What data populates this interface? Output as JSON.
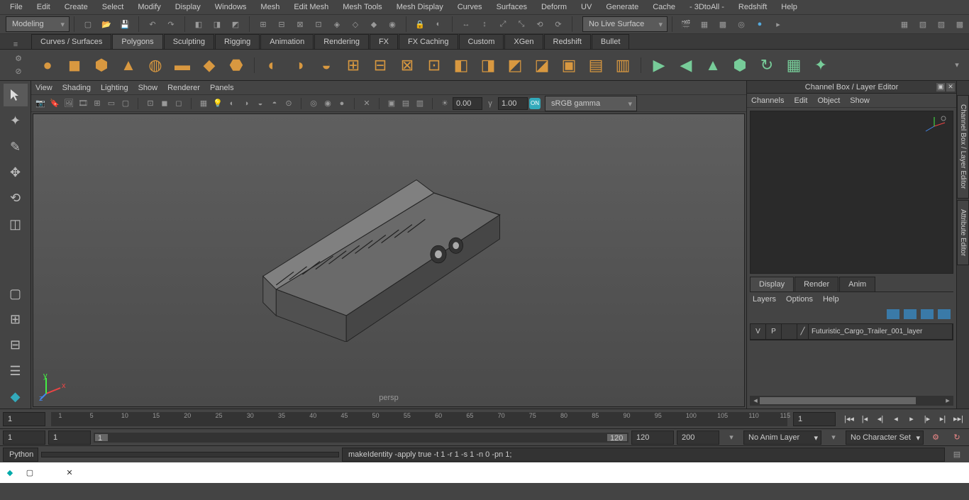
{
  "topmenu": [
    "File",
    "Edit",
    "Create",
    "Select",
    "Modify",
    "Display",
    "Windows",
    "Mesh",
    "Edit Mesh",
    "Mesh Tools",
    "Mesh Display",
    "Curves",
    "Surfaces",
    "Deform",
    "UV",
    "Generate",
    "Cache",
    "- 3DtoAll -",
    "Redshift",
    "Help"
  ],
  "workspace": "Modeling",
  "livesurface": "No Live Surface",
  "shelftabs": [
    "Curves / Surfaces",
    "Polygons",
    "Sculpting",
    "Rigging",
    "Animation",
    "Rendering",
    "FX",
    "FX Caching",
    "Custom",
    "XGen",
    "Redshift",
    "Bullet"
  ],
  "active_shelf": "Polygons",
  "panelmenu": [
    "View",
    "Shading",
    "Lighting",
    "Show",
    "Renderer",
    "Panels"
  ],
  "panel_exposure": "0.00",
  "panel_gamma": "1.00",
  "colorspace": "sRGB gamma",
  "camera": "persp",
  "right_title": "Channel Box / Layer Editor",
  "chmenu": [
    "Channels",
    "Edit",
    "Object",
    "Show"
  ],
  "layertabs": [
    "Display",
    "Render",
    "Anim"
  ],
  "active_layertab": "Display",
  "layermenu": [
    "Layers",
    "Options",
    "Help"
  ],
  "layer": {
    "v": "V",
    "p": "P",
    "name": "Futuristic_Cargo_Trailer_001_layer"
  },
  "righttabs": [
    "Channel Box / Layer Editor",
    "Attribute Editor"
  ],
  "timeline": {
    "start": "1",
    "end": "1",
    "ticks": [
      1,
      5,
      10,
      15,
      20,
      25,
      30,
      35,
      40,
      45,
      50,
      55,
      60,
      65,
      70,
      75,
      80,
      85,
      90,
      95,
      100,
      105,
      110,
      115
    ]
  },
  "range": {
    "a": "1",
    "b": "1",
    "c": "1",
    "d": "120",
    "e": "120",
    "f": "200"
  },
  "animlayer": "No Anim Layer",
  "charset": "No Character Set",
  "cmd": {
    "lang": "Python",
    "out": "makeIdentity -apply true -t 1 -r 1 -s 1 -n 0 -pn 1;"
  }
}
